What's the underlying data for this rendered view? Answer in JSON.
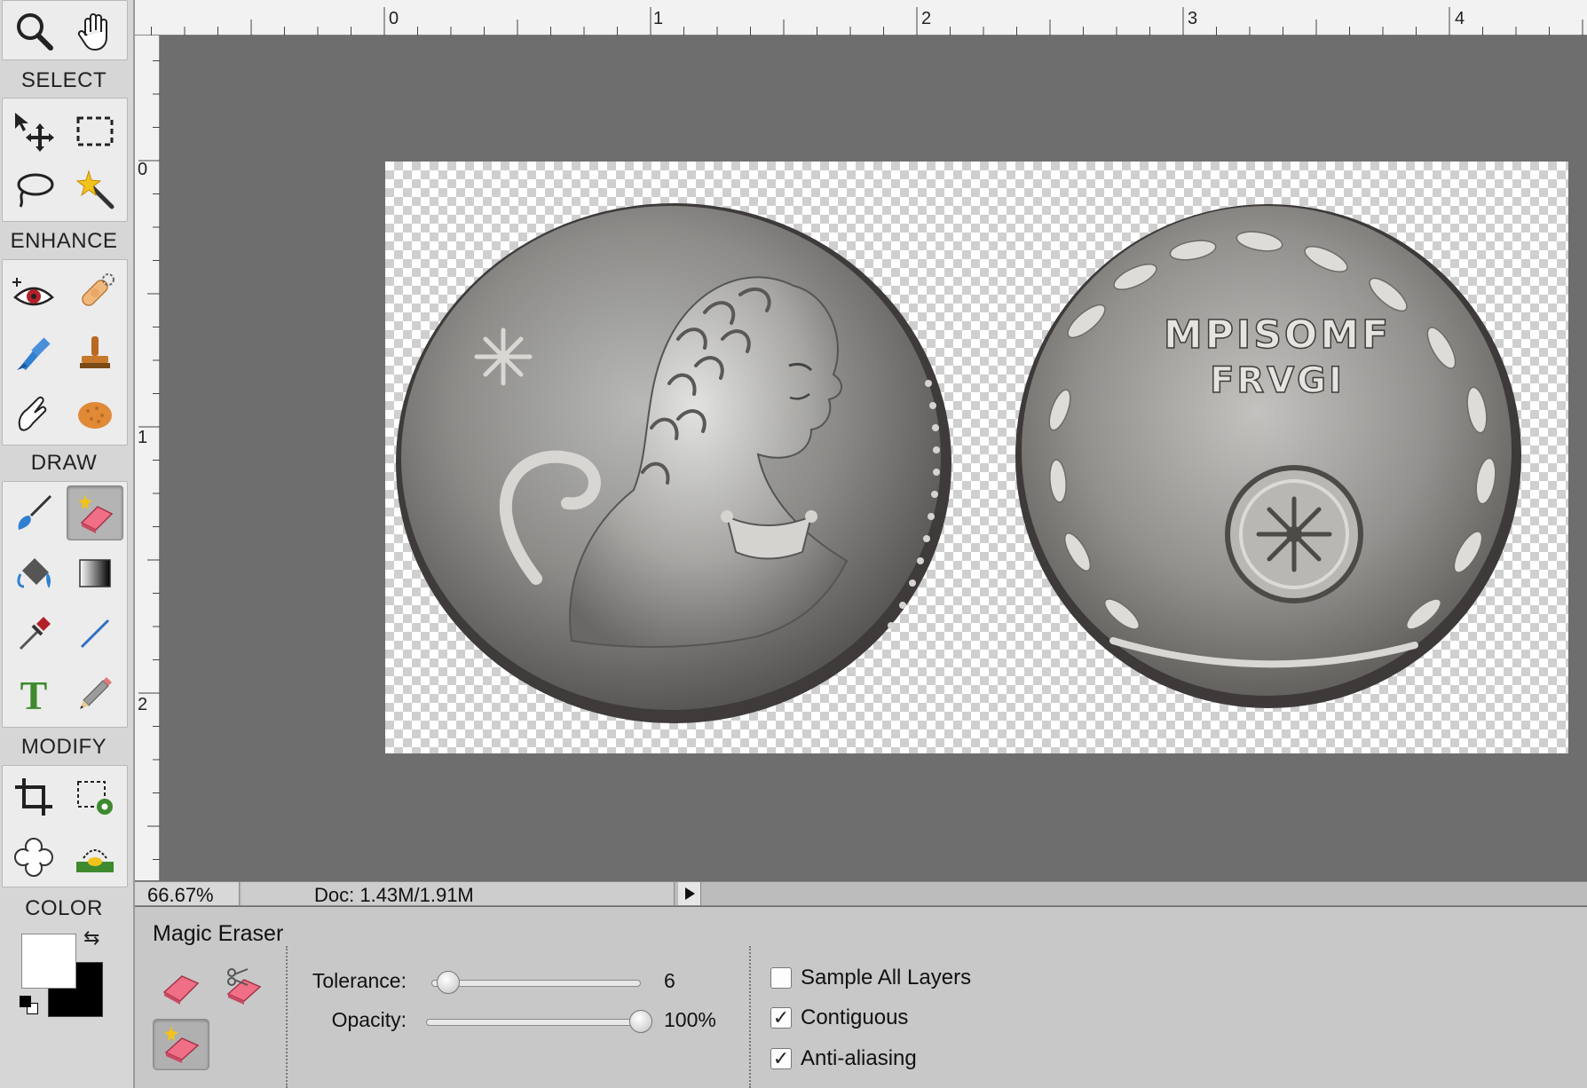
{
  "toolbox": {
    "sections": {
      "select": "SELECT",
      "enhance": "ENHANCE",
      "draw": "DRAW",
      "modify": "MODIFY",
      "color": "COLOR"
    },
    "tools": [
      {
        "name": "zoom-tool",
        "icon": "magnifier-icon"
      },
      {
        "name": "hand-tool",
        "icon": "hand-icon"
      },
      {
        "name": "move-tool",
        "icon": "move-arrow-icon"
      },
      {
        "name": "rectangular-marquee-tool",
        "icon": "dashed-rectangle-icon"
      },
      {
        "name": "lasso-tool",
        "icon": "lasso-icon"
      },
      {
        "name": "magic-wand-tool",
        "icon": "magic-wand-icon"
      },
      {
        "name": "red-eye-tool",
        "icon": "eye-icon"
      },
      {
        "name": "spot-healing-tool",
        "icon": "bandage-icon"
      },
      {
        "name": "blur-tool",
        "icon": "brush-blue-icon"
      },
      {
        "name": "clone-stamp-tool",
        "icon": "stamp-icon"
      },
      {
        "name": "smudge-tool",
        "icon": "finger-icon"
      },
      {
        "name": "sponge-tool",
        "icon": "sponge-icon"
      },
      {
        "name": "brush-tool",
        "icon": "paintbrush-icon"
      },
      {
        "name": "eraser-tool",
        "icon": "magic-eraser-icon",
        "active": true
      },
      {
        "name": "paint-bucket-tool",
        "icon": "paint-bucket-icon"
      },
      {
        "name": "gradient-tool",
        "icon": "gradient-icon"
      },
      {
        "name": "eyedropper-tool",
        "icon": "eyedropper-icon"
      },
      {
        "name": "line-tool",
        "icon": "line-icon"
      },
      {
        "name": "type-tool",
        "icon": "type-T-icon"
      },
      {
        "name": "pencil-tool",
        "icon": "pencil-icon"
      },
      {
        "name": "crop-tool",
        "icon": "crop-icon"
      },
      {
        "name": "recompose-tool",
        "icon": "recompose-icon"
      },
      {
        "name": "cookie-cutter-tool",
        "icon": "flower-shape-icon"
      },
      {
        "name": "straighten-tool",
        "icon": "straighten-icon"
      }
    ],
    "colors": {
      "foreground": "#ffffff",
      "background": "#000000"
    }
  },
  "rulers": {
    "top": [
      "0",
      "1",
      "2",
      "3",
      "4"
    ],
    "left": [
      "0",
      "1",
      "2"
    ]
  },
  "coin_inscription": [
    "MPISOMF",
    "FRVGI"
  ],
  "statusbar": {
    "zoom": "66.67%",
    "doc": "Doc: 1.43M/1.91M"
  },
  "options": {
    "tool_name": "Magic Eraser",
    "tolerance_label": "Tolerance:",
    "tolerance_value": "6",
    "tolerance": 6,
    "opacity_label": "Opacity:",
    "opacity_value": "100%",
    "opacity": 100,
    "checks": {
      "sample_all_layers": {
        "label": "Sample All Layers",
        "checked": false
      },
      "contiguous": {
        "label": "Contiguous",
        "checked": true
      },
      "anti_aliasing": {
        "label": "Anti-aliasing",
        "checked": true
      }
    }
  }
}
